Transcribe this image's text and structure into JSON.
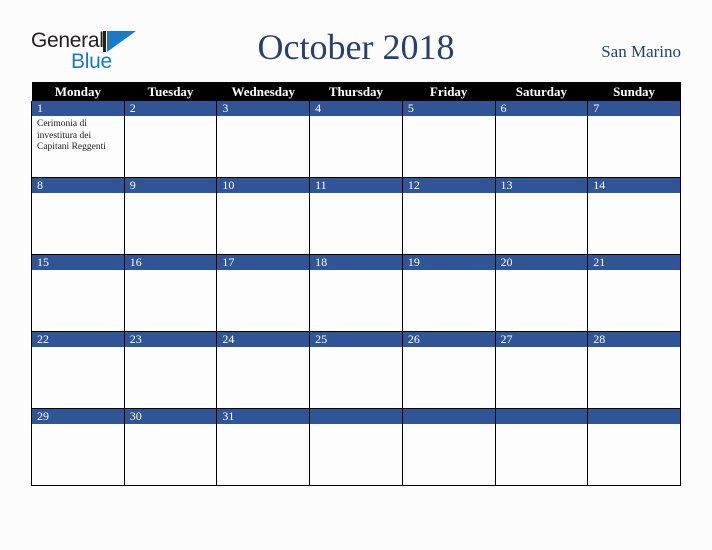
{
  "brand": {
    "name_part1": "General",
    "name_part2": "Blue",
    "mark_icon": "blue-triangle-icon",
    "color_dark": "#231f20",
    "color_blue": "#1a7ac4"
  },
  "header": {
    "title": "October 2018",
    "country": "San Marino",
    "title_color": "#27406e"
  },
  "calendar": {
    "header_bg": "#000000",
    "daynum_bg": "#2f5597",
    "weekdays": [
      "Monday",
      "Tuesday",
      "Wednesday",
      "Thursday",
      "Friday",
      "Saturday",
      "Sunday"
    ],
    "weeks": [
      [
        {
          "day": "1",
          "events": [
            "Cerimonia di investitura dei Capitani Reggenti"
          ]
        },
        {
          "day": "2",
          "events": []
        },
        {
          "day": "3",
          "events": []
        },
        {
          "day": "4",
          "events": []
        },
        {
          "day": "5",
          "events": []
        },
        {
          "day": "6",
          "events": []
        },
        {
          "day": "7",
          "events": []
        }
      ],
      [
        {
          "day": "8",
          "events": []
        },
        {
          "day": "9",
          "events": []
        },
        {
          "day": "10",
          "events": []
        },
        {
          "day": "11",
          "events": []
        },
        {
          "day": "12",
          "events": []
        },
        {
          "day": "13",
          "events": []
        },
        {
          "day": "14",
          "events": []
        }
      ],
      [
        {
          "day": "15",
          "events": []
        },
        {
          "day": "16",
          "events": []
        },
        {
          "day": "17",
          "events": []
        },
        {
          "day": "18",
          "events": []
        },
        {
          "day": "19",
          "events": []
        },
        {
          "day": "20",
          "events": []
        },
        {
          "day": "21",
          "events": []
        }
      ],
      [
        {
          "day": "22",
          "events": []
        },
        {
          "day": "23",
          "events": []
        },
        {
          "day": "24",
          "events": []
        },
        {
          "day": "25",
          "events": []
        },
        {
          "day": "26",
          "events": []
        },
        {
          "day": "27",
          "events": []
        },
        {
          "day": "28",
          "events": []
        }
      ],
      [
        {
          "day": "29",
          "events": []
        },
        {
          "day": "30",
          "events": []
        },
        {
          "day": "31",
          "events": []
        },
        {
          "day": "",
          "events": []
        },
        {
          "day": "",
          "events": []
        },
        {
          "day": "",
          "events": []
        },
        {
          "day": "",
          "events": []
        }
      ]
    ]
  }
}
